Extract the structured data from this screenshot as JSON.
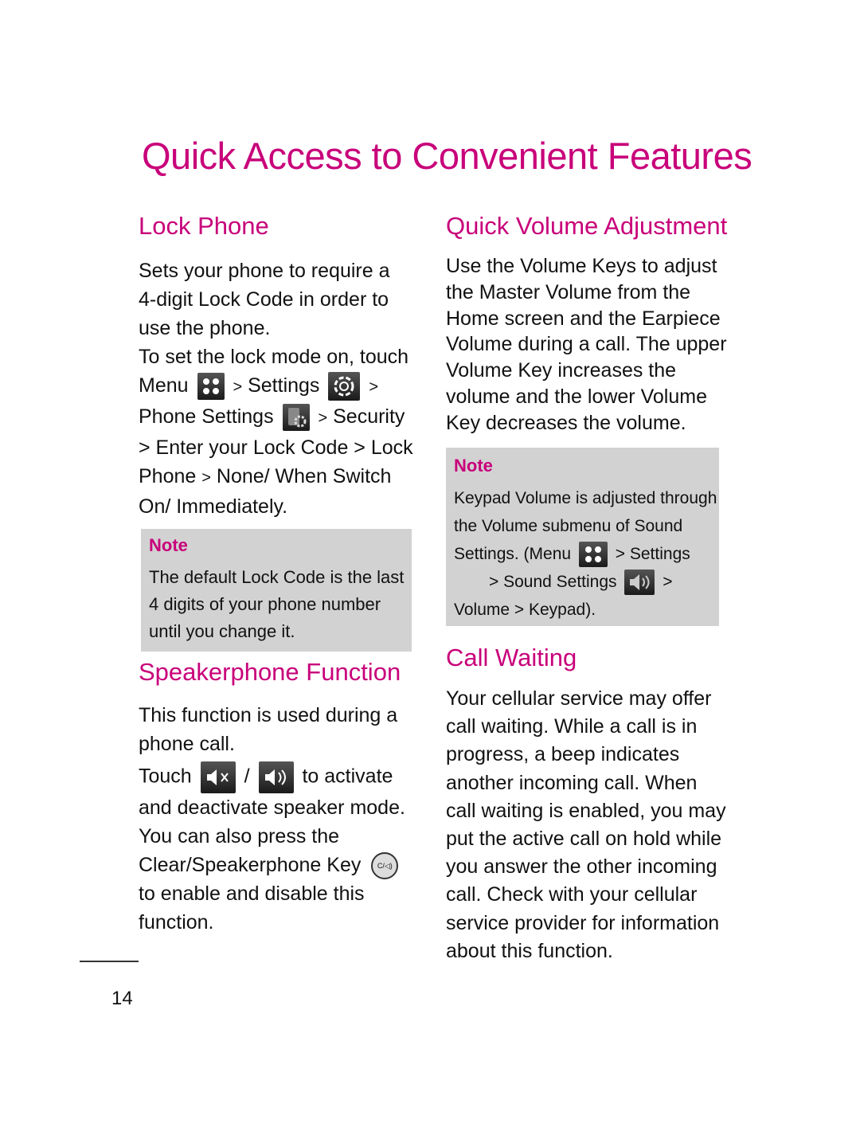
{
  "page_title": "Quick Access to Convenient Features",
  "page_number": "14",
  "lock_phone": {
    "heading": "Lock Phone",
    "intro": [
      "Sets your phone to require a",
      "4-digit Lock Code in order to",
      "use the phone."
    ],
    "touch_line": "To set the lock mode on, touch",
    "path": {
      "menu": "Menu",
      "sep": ">",
      "settings": "Settings",
      "phone_settings": "Phone Settings",
      "security": "Security",
      "enter_code": "> Enter your Lock Code >",
      "lock": "Lock",
      "phone": "Phone",
      "none_when": "None/ When Switch",
      "on_immediately": "On/ Immediately",
      "period": "."
    },
    "note": {
      "label": "Note",
      "lines": [
        "The default Lock Code is the last",
        "4 digits of your phone number",
        "until you change it."
      ]
    }
  },
  "speakerphone": {
    "heading": "Speakerphone Function",
    "intro": [
      "This function is used during a",
      "phone call."
    ],
    "touch": "Touch",
    "slash": "/",
    "activate": "to activate",
    "lines": [
      "and deactivate speaker mode.",
      "You can also press the"
    ],
    "key_line": "Clear/Speakerphone Key",
    "end_lines": [
      "to enable and disable this",
      "function."
    ],
    "key_glyph": "C/◁)"
  },
  "quick_volume": {
    "heading": "Quick Volume Adjustment",
    "lines": [
      "Use the Volume Keys to adjust",
      "the Master Volume from the",
      "Home screen and the Earpiece",
      "Volume during a call. The upper",
      "Volume Key increases the",
      "volume and the lower Volume",
      "Key decreases the volume."
    ],
    "note": {
      "label": "Note",
      "line1": "Keypad Volume is adjusted through",
      "line2": "the Volume submenu of Sound",
      "line3_pre": "Settings. (",
      "menu": "Menu",
      "settings": "> Settings",
      "sound_settings": "> Sound Settings",
      "gt": ">",
      "volume": "Volume",
      "keypad": "> Keypad",
      "close": ")."
    }
  },
  "call_waiting": {
    "heading": "Call Waiting",
    "lines": [
      "Your cellular service may offer",
      "call waiting. While a call is in",
      "progress, a beep indicates",
      "another incoming call. When",
      "call waiting is enabled, you may",
      "put the active call on hold while",
      "you answer the other incoming",
      "call. Check with your cellular",
      "service provider for information",
      "about this function."
    ]
  }
}
